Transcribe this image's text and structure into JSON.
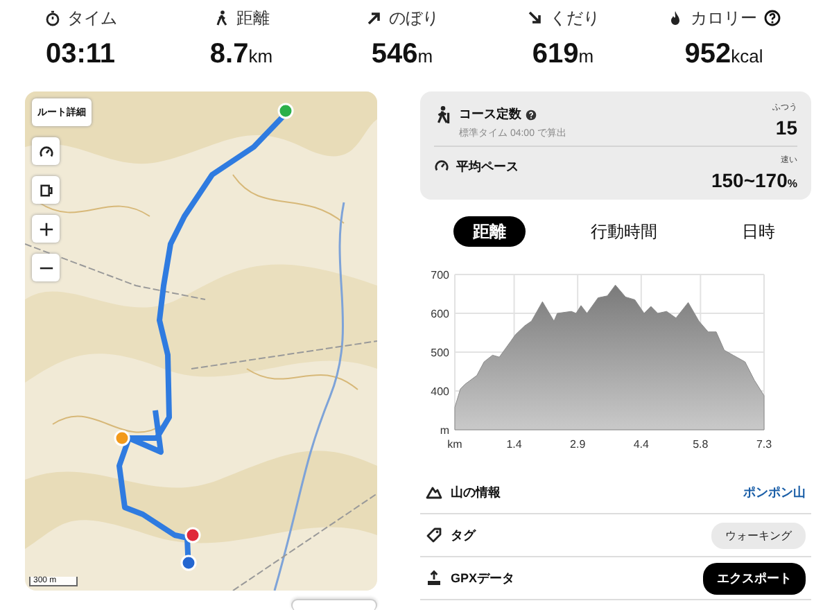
{
  "stats": [
    {
      "kind": "time",
      "label": "タイム",
      "value": "03:11",
      "help": false
    },
    {
      "kind": "distance",
      "label": "距離",
      "value": "8.7",
      "unit": "km",
      "help": false
    },
    {
      "kind": "ascent",
      "label": "のぼり",
      "value": "546",
      "unit": "m",
      "help": false
    },
    {
      "kind": "descent",
      "label": "くだり",
      "value": "619",
      "unit": "m",
      "help": false
    },
    {
      "kind": "calorie",
      "label": "カロリー",
      "value": "952",
      "unit": "kcal",
      "help": true
    }
  ],
  "map": {
    "kind": "picture",
    "route_button": "ルート詳細",
    "controls": [
      {
        "kind": "speed"
      },
      {
        "kind": "cup"
      },
      {
        "kind": "zoom_in"
      },
      {
        "kind": "zoom_out"
      }
    ],
    "scale": "300 m"
  },
  "course": [
    {
      "kind": "hiker",
      "title": "コース定数",
      "help": true,
      "note": "標準タイム 04:00 で算出",
      "rating": "ふつう",
      "value": "15"
    },
    {
      "kind": "pace",
      "title": "平均ペース",
      "help": false,
      "rating": "速い",
      "value": "150~170",
      "unit": "%"
    }
  ],
  "tabs": [
    {
      "label": "距離",
      "selected": true
    },
    {
      "label": "行動時間",
      "selected": false
    },
    {
      "label": "日時",
      "selected": false
    }
  ],
  "chart_data": {
    "type": "area",
    "x": [
      0,
      0.13,
      0.24,
      0.52,
      0.69,
      0.89,
      1.05,
      1.32,
      1.43,
      1.65,
      1.81,
      2.07,
      2.34,
      2.42,
      2.75,
      2.86,
      2.98,
      3.12,
      3.38,
      3.6,
      3.79,
      4.03,
      4.25,
      4.47,
      4.63,
      4.79,
      5.0,
      5.22,
      5.51,
      5.76,
      5.98,
      6.17,
      6.36,
      6.57,
      6.85,
      7.07,
      7.3
    ],
    "grid": true,
    "series": [
      {
        "color": "#8a8a8a",
        "values": [
          358,
          405,
          417,
          440,
          475,
          492,
          487,
          528,
          545,
          568,
          580,
          630,
          580,
          600,
          605,
          600,
          620,
          600,
          640,
          645,
          673,
          642,
          635,
          600,
          618,
          600,
          605,
          588,
          628,
          580,
          552,
          552,
          505,
          492,
          475,
          428,
          388
        ]
      }
    ],
    "xlim": [
      0,
      7.3
    ],
    "ylim": [
      300,
      700
    ],
    "xticks": [
      {
        "value": 0,
        "label": "km"
      },
      1.4,
      2.9,
      4.4,
      5.8,
      7.3
    ],
    "yticks": [
      {
        "value": 300,
        "label": "m"
      },
      400,
      500,
      600,
      700
    ]
  },
  "info": [
    {
      "kind": "link",
      "label": "山の情報",
      "value": "ポンポン山"
    },
    {
      "kind": "chip",
      "label": "タグ",
      "value": "ウォーキング"
    },
    {
      "kind": "button",
      "label": "GPXデータ",
      "value": "エクスポート"
    }
  ]
}
